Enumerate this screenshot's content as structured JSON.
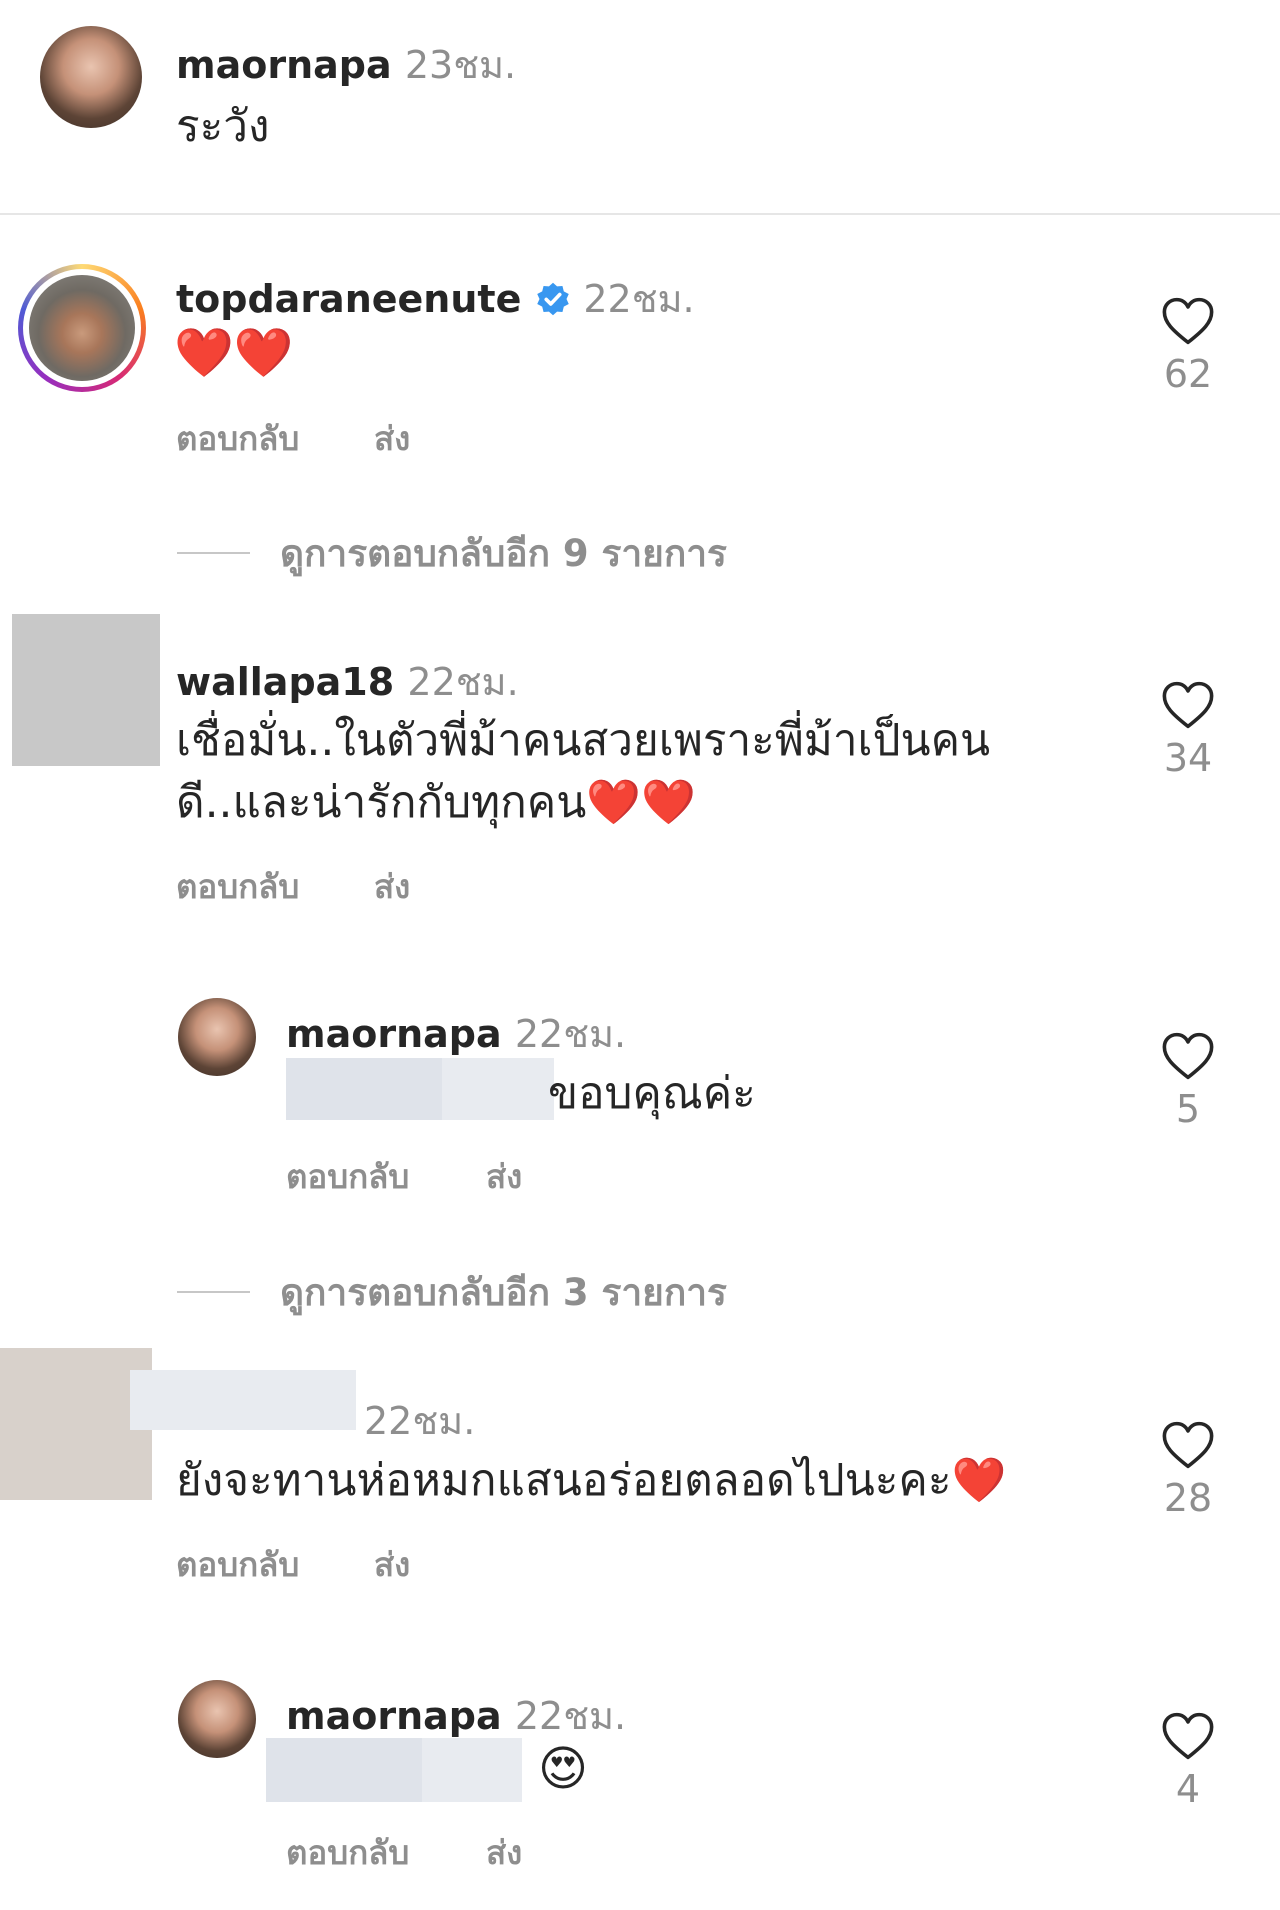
{
  "comments": [
    {
      "username": "maornapa",
      "time": "23ชม.",
      "text": "ระวัง"
    },
    {
      "username": "topdaraneenute",
      "verified": true,
      "time": "22ชม.",
      "text": "❤️❤️",
      "likes": "62",
      "reply_label": "ตอบกลับ",
      "send_label": "ส่ง",
      "view_replies": "ดูการตอบกลับอีก 9 รายการ"
    },
    {
      "username": "wallapa18",
      "time": "22ชม.",
      "text_line1": "เชื่อมั่น..ในตัวพี่ม้าคนสวยเพราะพี่ม้าเป็นคน",
      "text_line2": "ดี..และน่ารักกับทุกคน❤️❤️",
      "likes": "34",
      "reply_label": "ตอบกลับ",
      "send_label": "ส่ง"
    },
    {
      "username": "maornapa",
      "time": "22ชม.",
      "text": "ขอบคุณค่ะ",
      "likes": "5",
      "reply_label": "ตอบกลับ",
      "send_label": "ส่ง",
      "view_replies": "ดูการตอบกลับอีก 3 รายการ"
    },
    {
      "time": "22ชม.",
      "text": "ยังจะทานห่อหมกแสนอร่อยตลอดไปนะคะ❤️",
      "likes": "28",
      "reply_label": "ตอบกลับ",
      "send_label": "ส่ง"
    },
    {
      "username": "maornapa",
      "time": "22ชม.",
      "text": "😍",
      "likes": "4",
      "reply_label": "ตอบกลับ",
      "send_label": "ส่ง"
    }
  ],
  "icons": {
    "like": "heart-outline-icon",
    "verified": "verified-badge-icon"
  },
  "colors": {
    "text": "#262626",
    "secondary": "#8e8e8e",
    "verified": "#3897f0"
  }
}
